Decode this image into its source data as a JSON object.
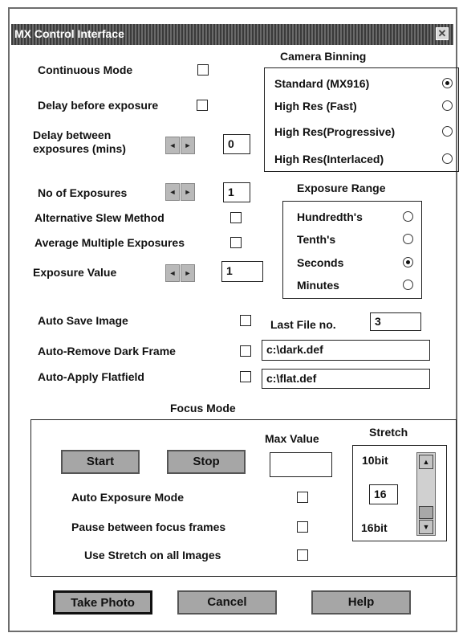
{
  "window": {
    "title": "MX Control Interface",
    "close_glyph": "✕"
  },
  "labels": {
    "continuous_mode": "Continuous Mode",
    "delay_before_exposure": "Delay before exposure",
    "delay_between_line1": "Delay between",
    "delay_between_line2": "exposures (mins)",
    "no_of_exposures": "No of Exposures",
    "alt_slew": "Alternative Slew Method",
    "avg_multiple": "Average Multiple Exposures",
    "exposure_value": "Exposure Value",
    "auto_save": "Auto Save Image",
    "last_file_no": "Last File no.",
    "auto_remove_dark": "Auto-Remove Dark Frame",
    "auto_apply_flat": "Auto-Apply Flatfield"
  },
  "values": {
    "delay_between": "0",
    "no_of_exposures": "1",
    "exposure_value": "1",
    "last_file_no": "3",
    "dark_frame_path": "c:\\dark.def",
    "flatfield_path": "c:\\flat.def"
  },
  "camera_binning": {
    "title": "Camera Binning",
    "options": [
      "Standard (MX916)",
      "High Res (Fast)",
      "High Res(Progressive)",
      "High Res(Interlaced)"
    ],
    "selected_index": 0
  },
  "exposure_range": {
    "title": "Exposure Range",
    "options": [
      "Hundredth's",
      "Tenth's",
      "Seconds",
      "Minutes"
    ],
    "selected_index": 2
  },
  "focus": {
    "title": "Focus Mode",
    "start_label": "Start",
    "stop_label": "Stop",
    "max_value_label": "Max Value",
    "max_value": "",
    "auto_exposure_mode": "Auto Exposure Mode",
    "pause_between": "Pause between focus frames",
    "use_stretch": "Use Stretch on all Images",
    "stretch_label": "Stretch",
    "stretch_top": "10bit",
    "stretch_bottom": "16bit",
    "stretch_value": "16"
  },
  "buttons": {
    "take_photo": "Take Photo",
    "cancel": "Cancel",
    "help": "Help"
  },
  "icons": {
    "spin_left": "◄",
    "spin_right": "►",
    "scroll_up": "▲",
    "scroll_down": "▼"
  }
}
